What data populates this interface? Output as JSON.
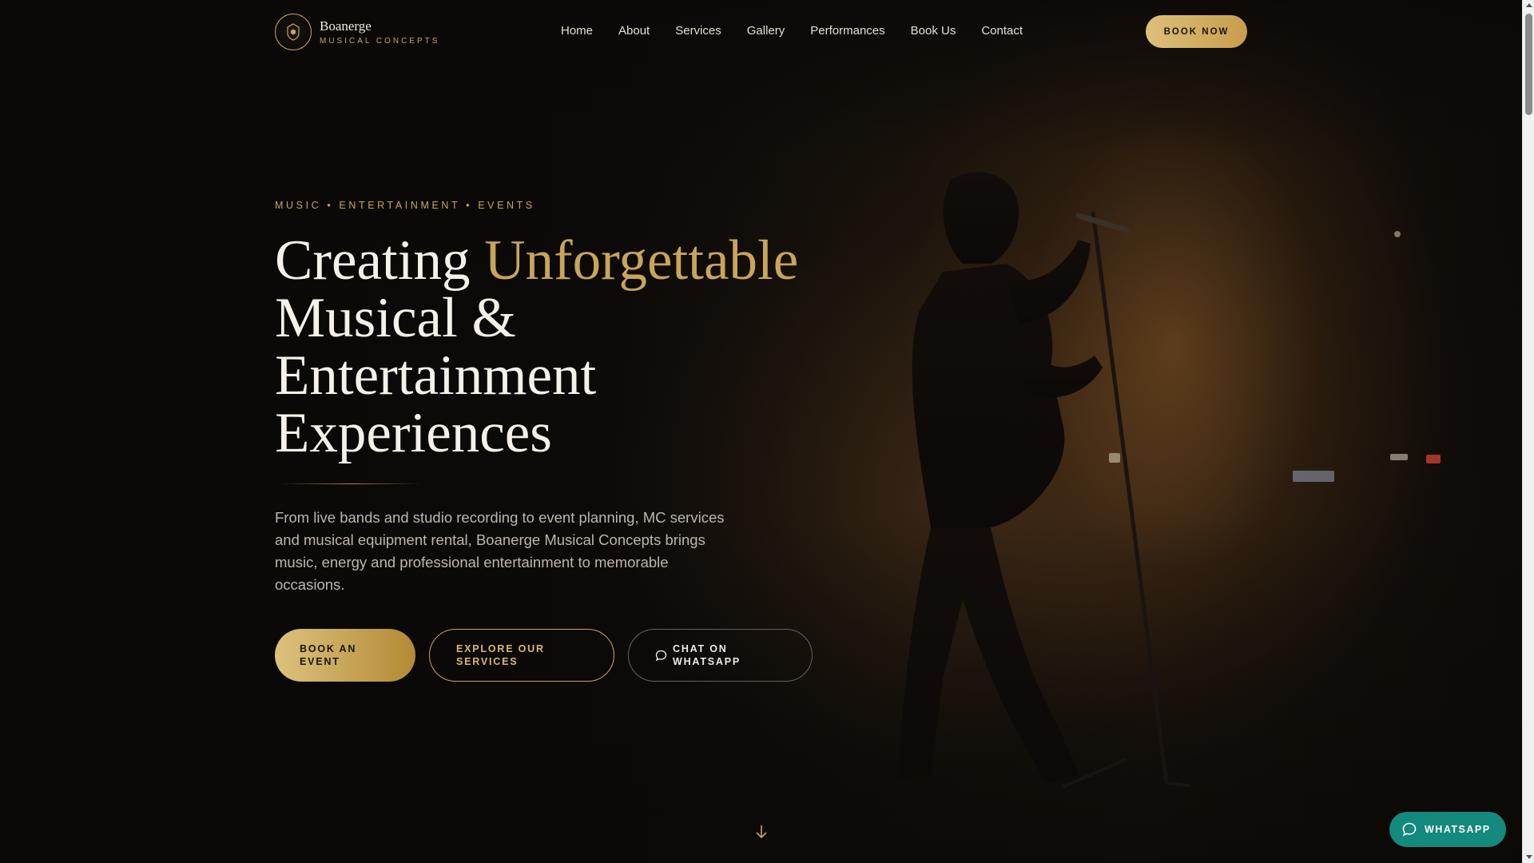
{
  "brand": {
    "name": "Boanerge",
    "tagline": "MUSICAL CONCEPTS",
    "logo_icon": "lion-crest-icon",
    "accent_color": "#c9a45a"
  },
  "nav": {
    "items": [
      {
        "label": "Home"
      },
      {
        "label": "About"
      },
      {
        "label": "Services"
      },
      {
        "label": "Gallery"
      },
      {
        "label": "Performances"
      },
      {
        "label": "Book Us"
      },
      {
        "label": "Contact"
      }
    ],
    "cta_label": "BOOK NOW"
  },
  "hero": {
    "eyebrow": "MUSIC • ENTERTAINMENT • EVENTS",
    "headline_lead": "Creating ",
    "headline_accent": "Unforgettable",
    "headline_rest": "Musical & Entertainment Experiences",
    "description": "From live bands and studio recording to event planning, MC services and musical equipment rental, Boanerge Musical Concepts brings music, energy and professional entertainment to memorable occasions.",
    "buttons": {
      "primary": "BOOK AN EVENT",
      "secondary": "EXPLORE OUR SERVICES",
      "whatsapp": "CHAT ON WHATSAPP"
    },
    "scroll_icon": "arrow-down-icon"
  },
  "floating": {
    "whatsapp_label": "WHATSAPP",
    "whatsapp_icon": "chat-bubble-icon",
    "whatsapp_color": "#14897d"
  }
}
